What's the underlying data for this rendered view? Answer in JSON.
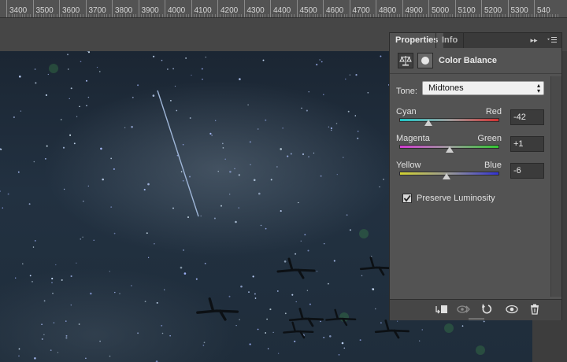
{
  "ruler": {
    "labels": [
      "3400",
      "3500",
      "3600",
      "3700",
      "3800",
      "3900",
      "4000",
      "4100",
      "4200",
      "4300",
      "4400",
      "4500",
      "4600",
      "4700",
      "4800",
      "4900",
      "5000",
      "5100",
      "5200",
      "5300",
      "540"
    ]
  },
  "panel": {
    "tabs": [
      {
        "label": "Properties",
        "active": true
      },
      {
        "label": "Info",
        "active": false
      }
    ],
    "collapse_glyph": "▸▸",
    "title": "Color Balance",
    "tone": {
      "label": "Tone:",
      "value": "Midtones"
    },
    "sliders": [
      {
        "left_label": "Cyan",
        "right_label": "Red",
        "value": "-42",
        "level": -42,
        "gradient": [
          "#1fc8c8",
          "#9a9a9a",
          "#d23232"
        ]
      },
      {
        "left_label": "Magenta",
        "right_label": "Green",
        "value": "+1",
        "level": 1,
        "gradient": [
          "#d23cd2",
          "#9a9a9a",
          "#32c832"
        ]
      },
      {
        "left_label": "Yellow",
        "right_label": "Blue",
        "value": "-6",
        "level": -6,
        "gradient": [
          "#d2d232",
          "#9a9a9a",
          "#3232d2"
        ]
      }
    ],
    "preserve_luminosity": {
      "label": "Preserve Luminosity",
      "checked": true
    },
    "footer_icons": [
      "clip-to-layer-icon",
      "view-previous-state-icon",
      "reset-icon",
      "visibility-eye-icon",
      "trash-icon"
    ]
  }
}
